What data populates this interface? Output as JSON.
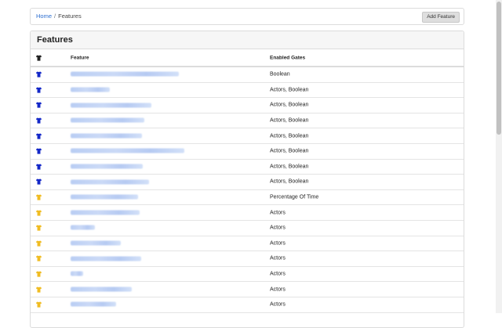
{
  "breadcrumb": {
    "home": "Home",
    "separator": "/",
    "current": "Features"
  },
  "header": {
    "add_button": "Add Feature"
  },
  "card": {
    "title": "Features"
  },
  "table": {
    "headers": {
      "feature": "Feature",
      "gates": "Enabled Gates"
    },
    "status_colors": {
      "on": "#1428c8",
      "partial": "#f0bc22",
      "header": "#222222"
    },
    "rows": [
      {
        "status": "on",
        "gates": "Boolean"
      },
      {
        "status": "on",
        "gates": "Actors, Boolean"
      },
      {
        "status": "on",
        "gates": "Actors, Boolean"
      },
      {
        "status": "on",
        "gates": "Actors, Boolean"
      },
      {
        "status": "on",
        "gates": "Actors, Boolean"
      },
      {
        "status": "on",
        "gates": "Actors, Boolean"
      },
      {
        "status": "on",
        "gates": "Actors, Boolean"
      },
      {
        "status": "on",
        "gates": "Actors, Boolean"
      },
      {
        "status": "partial",
        "gates": "Percentage Of Time"
      },
      {
        "status": "partial",
        "gates": "Actors"
      },
      {
        "status": "partial",
        "gates": "Actors"
      },
      {
        "status": "partial",
        "gates": "Actors"
      },
      {
        "status": "partial",
        "gates": "Actors"
      },
      {
        "status": "partial",
        "gates": "Actors"
      },
      {
        "status": "partial",
        "gates": "Actors"
      },
      {
        "status": "partial",
        "gates": "Actors"
      }
    ]
  }
}
